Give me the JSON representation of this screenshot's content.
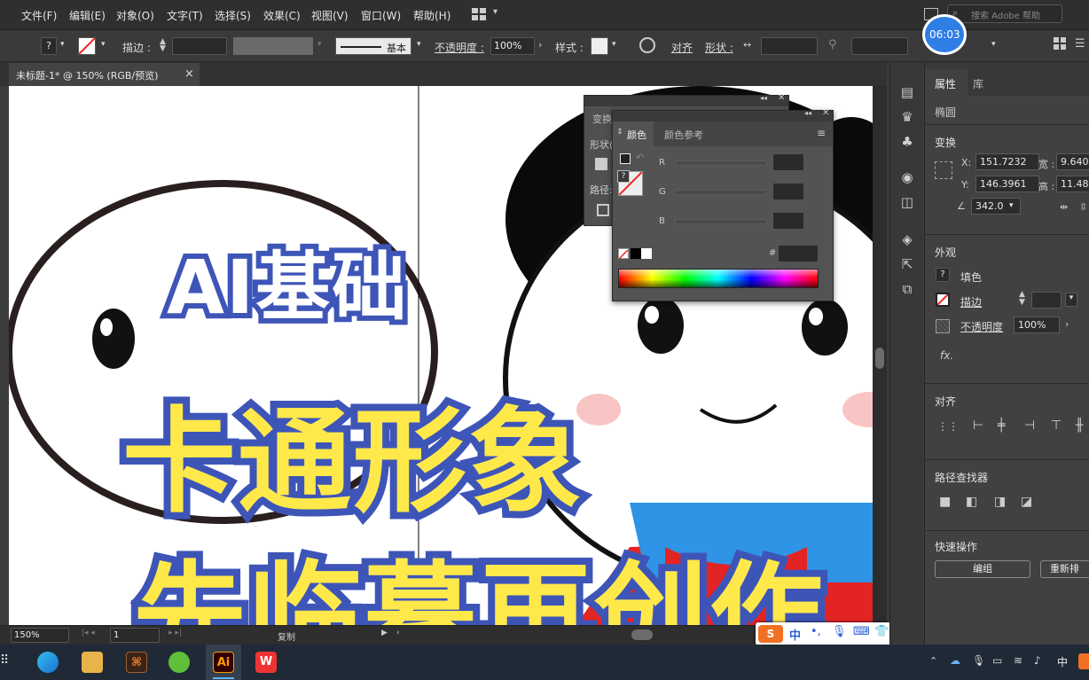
{
  "menubar": {
    "items": [
      "文件(F)",
      "编辑(E)",
      "对象(O)",
      "文字(T)",
      "选择(S)",
      "效果(C)",
      "视图(V)",
      "窗口(W)",
      "帮助(H)"
    ],
    "search_placeholder": "搜索 Adobe 帮助",
    "timer": "06:03"
  },
  "control": {
    "stroke_label": "描边 :",
    "stroke_style": "基本",
    "opacity_label": "不透明度 :",
    "opacity_value": "100%",
    "style_label": "样式 :",
    "align_label": "对齐",
    "shape_label": "形状 :",
    "fill_icon": "question-mark"
  },
  "document": {
    "tab_title": "未标题-1* @ 150% (RGB/预览)",
    "close_glyph": "×"
  },
  "canvas": {
    "title_line1": "AI基础",
    "title_line2": "卡通形象",
    "title_line3": "先临摹再创作"
  },
  "status": {
    "zoom": "150%",
    "artboard": "1",
    "status_text": "复制"
  },
  "transform_panel": {
    "title": "变换",
    "shape_label": "形状(",
    "path_label": "路径:"
  },
  "color_panel": {
    "tab_color": "颜色",
    "tab_guide": "颜色参考",
    "r_label": "R",
    "g_label": "G",
    "b_label": "B",
    "hex_label": "#"
  },
  "properties": {
    "tab_props": "属性",
    "tab_lib": "库",
    "object_type": "椭圆",
    "transform_title": "变换",
    "x_label": "X:",
    "x_value": "151.7232",
    "y_label": "Y:",
    "y_value": "146.3961",
    "w_label": "宽 :",
    "w_value": "9.640",
    "h_label": "高 :",
    "h_value": "11.48",
    "angle_value": "342.0",
    "appearance_title": "外观",
    "fill_label": "填色",
    "stroke_label": "描边",
    "opacity_label": "不透明度",
    "opacity_value": "100%",
    "fx_label": "fx.",
    "align_title": "对齐",
    "pathfinder_title": "路径查找器",
    "quick_title": "快速操作",
    "group_button": "编组",
    "rearrange_button": "重新排"
  },
  "taskbar": {
    "ime_mode": "中",
    "ai_label": "Ai",
    "wps_label": "W",
    "ime_tray": "中"
  },
  "colors": {
    "accent_blue": "#3e55b8",
    "title_yellow": "#ffe94a",
    "timer_blue": "#2f7ee6"
  }
}
